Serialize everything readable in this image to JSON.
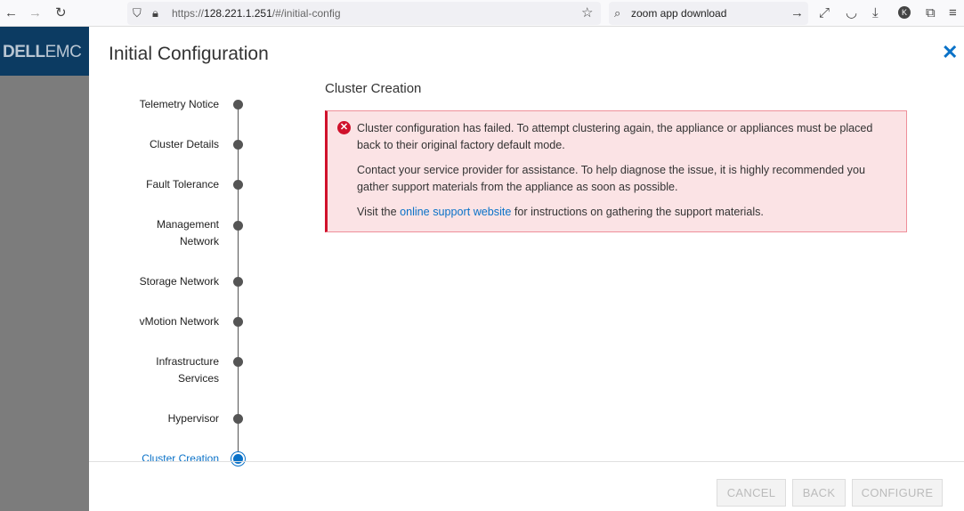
{
  "browser": {
    "url_prefix": "https://",
    "url_host": "128.221.1.251",
    "url_path": "/#/initial-config",
    "search_text": "zoom app download",
    "profile_initial": "K"
  },
  "logo": {
    "dell": "DELL",
    "emc": "EMC"
  },
  "modal": {
    "title": "Initial Configuration",
    "close": "✕"
  },
  "steps": [
    {
      "label": "Telemetry Notice"
    },
    {
      "label": "Cluster Details"
    },
    {
      "label": "Fault Tolerance"
    },
    {
      "label": "Management Network"
    },
    {
      "label": "Storage Network"
    },
    {
      "label": "vMotion Network"
    },
    {
      "label": "Infrastructure Services"
    },
    {
      "label": "Hypervisor"
    },
    {
      "label": "Cluster Creation",
      "active": true
    }
  ],
  "section_title": "Cluster Creation",
  "alert": {
    "p1": "Cluster configuration has failed. To attempt clustering again, the appliance or appliances must be placed back to their original factory default mode.",
    "p2": "Contact your service provider for assistance. To help diagnose the issue, it is highly recommended you gather support materials from the appliance as soon as possible.",
    "p3_before": "Visit the ",
    "p3_link": "online support website",
    "p3_after": " for instructions on gathering the support materials."
  },
  "buttons": {
    "cancel": "CANCEL",
    "back": "BACK",
    "configure": "CONFIGURE"
  }
}
